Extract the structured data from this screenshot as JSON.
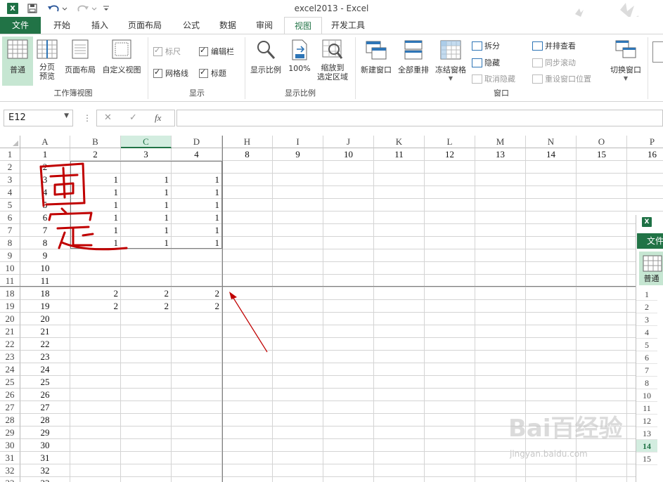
{
  "window": {
    "title": "excel2013 - Excel"
  },
  "tabs": [
    "文件",
    "开始",
    "插入",
    "页面布局",
    "公式",
    "数据",
    "审阅",
    "视图",
    "开发工具"
  ],
  "ribbon": {
    "views": {
      "normal": "普通",
      "page_break_1": "分页",
      "page_break_2": "预览",
      "page_layout": "页面布局",
      "custom": "自定义视图",
      "group": "工作簿视图"
    },
    "show": {
      "ruler": "标尺",
      "formula_bar": "编辑栏",
      "gridlines": "网格线",
      "headings": "标题",
      "group": "显示"
    },
    "zoom": {
      "zoom": "显示比例",
      "hundred": "100%",
      "sel_1": "缩放到",
      "sel_2": "选定区域",
      "group": "显示比例"
    },
    "window": {
      "new_window": "新建窗口",
      "arrange_all": "全部重排",
      "freeze": "冻结窗格",
      "split": "拆分",
      "hide": "隐藏",
      "unhide": "取消隐藏",
      "side_by_side": "并排查看",
      "sync_scroll": "同步滚动",
      "reset_position": "重设窗口位置",
      "switch": "切换窗口",
      "group": "窗口"
    }
  },
  "formula_bar": {
    "name_box": "E12",
    "cancel": "✕",
    "enter": "✓",
    "fx": "fx",
    "value": ""
  },
  "columns": [
    "A",
    "B",
    "C",
    "D",
    "H",
    "I",
    "J",
    "K",
    "L",
    "M",
    "N",
    "O",
    "P"
  ],
  "selected_column": "C",
  "rows": [
    {
      "n": "1",
      "cells": [
        "1",
        "2",
        "3",
        "4",
        "8",
        "9",
        "10",
        "11",
        "12",
        "13",
        "14",
        "15",
        "16"
      ]
    },
    {
      "n": "2",
      "cells": [
        "2",
        "",
        "",
        "",
        "",
        "",
        "",
        "",
        "",
        "",
        "",
        "",
        ""
      ]
    },
    {
      "n": "3",
      "cells": [
        "3",
        "1",
        "1",
        "1",
        "",
        "",
        "",
        "",
        "",
        "",
        "",
        "",
        ""
      ]
    },
    {
      "n": "4",
      "cells": [
        "4",
        "1",
        "1",
        "1",
        "",
        "",
        "",
        "",
        "",
        "",
        "",
        "",
        ""
      ]
    },
    {
      "n": "5",
      "cells": [
        "5",
        "1",
        "1",
        "1",
        "",
        "",
        "",
        "",
        "",
        "",
        "",
        "",
        ""
      ]
    },
    {
      "n": "6",
      "cells": [
        "6",
        "1",
        "1",
        "1",
        "",
        "",
        "",
        "",
        "",
        "",
        "",
        "",
        ""
      ]
    },
    {
      "n": "7",
      "cells": [
        "7",
        "1",
        "1",
        "1",
        "",
        "",
        "",
        "",
        "",
        "",
        "",
        "",
        ""
      ]
    },
    {
      "n": "8",
      "cells": [
        "8",
        "1",
        "1",
        "1",
        "",
        "",
        "",
        "",
        "",
        "",
        "",
        "",
        ""
      ]
    },
    {
      "n": "9",
      "cells": [
        "9",
        "",
        "",
        "",
        "",
        "",
        "",
        "",
        "",
        "",
        "",
        "",
        ""
      ]
    },
    {
      "n": "10",
      "cells": [
        "10",
        "",
        "",
        "",
        "",
        "",
        "",
        "",
        "",
        "",
        "",
        "",
        ""
      ]
    },
    {
      "n": "11",
      "cells": [
        "11",
        "",
        "",
        "",
        "",
        "",
        "",
        "",
        "",
        "",
        "",
        "",
        ""
      ]
    },
    {
      "n": "18",
      "cells": [
        "18",
        "2",
        "2",
        "2",
        "",
        "",
        "",
        "",
        "",
        "",
        "",
        "",
        ""
      ]
    },
    {
      "n": "19",
      "cells": [
        "19",
        "2",
        "2",
        "2",
        "",
        "",
        "",
        "",
        "",
        "",
        "",
        "",
        ""
      ]
    },
    {
      "n": "20",
      "cells": [
        "20",
        "",
        "",
        "",
        "",
        "",
        "",
        "",
        "",
        "",
        "",
        "",
        ""
      ]
    },
    {
      "n": "21",
      "cells": [
        "21",
        "",
        "",
        "",
        "",
        "",
        "",
        "",
        "",
        "",
        "",
        "",
        ""
      ]
    },
    {
      "n": "22",
      "cells": [
        "22",
        "",
        "",
        "",
        "",
        "",
        "",
        "",
        "",
        "",
        "",
        "",
        ""
      ]
    },
    {
      "n": "23",
      "cells": [
        "23",
        "",
        "",
        "",
        "",
        "",
        "",
        "",
        "",
        "",
        "",
        "",
        ""
      ]
    },
    {
      "n": "24",
      "cells": [
        "24",
        "",
        "",
        "",
        "",
        "",
        "",
        "",
        "",
        "",
        "",
        "",
        ""
      ]
    },
    {
      "n": "25",
      "cells": [
        "25",
        "",
        "",
        "",
        "",
        "",
        "",
        "",
        "",
        "",
        "",
        "",
        ""
      ]
    },
    {
      "n": "26",
      "cells": [
        "26",
        "",
        "",
        "",
        "",
        "",
        "",
        "",
        "",
        "",
        "",
        "",
        ""
      ]
    },
    {
      "n": "27",
      "cells": [
        "27",
        "",
        "",
        "",
        "",
        "",
        "",
        "",
        "",
        "",
        "",
        "",
        ""
      ]
    },
    {
      "n": "28",
      "cells": [
        "28",
        "",
        "",
        "",
        "",
        "",
        "",
        "",
        "",
        "",
        "",
        "",
        ""
      ]
    },
    {
      "n": "29",
      "cells": [
        "29",
        "",
        "",
        "",
        "",
        "",
        "",
        "",
        "",
        "",
        "",
        "",
        ""
      ]
    },
    {
      "n": "30",
      "cells": [
        "30",
        "",
        "",
        "",
        "",
        "",
        "",
        "",
        "",
        "",
        "",
        "",
        ""
      ]
    },
    {
      "n": "31",
      "cells": [
        "31",
        "",
        "",
        "",
        "",
        "",
        "",
        "",
        "",
        "",
        "",
        "",
        ""
      ]
    },
    {
      "n": "32",
      "cells": [
        "32",
        "",
        "",
        "",
        "",
        "",
        "",
        "",
        "",
        "",
        "",
        "",
        ""
      ]
    },
    {
      "n": "33",
      "cells": [
        "33",
        "",
        "",
        "",
        "",
        "",
        "",
        "",
        "",
        "",
        "",
        "",
        ""
      ]
    }
  ],
  "annotation": {
    "text": "固定",
    "color": "#c00000"
  },
  "second_window": {
    "tab": "文件",
    "button": "普通",
    "rows": [
      "1",
      "2",
      "3",
      "4",
      "5",
      "6",
      "7",
      "8",
      "10",
      "11",
      "12",
      "13",
      "14",
      "15"
    ],
    "selected_row": "14"
  },
  "watermark": {
    "text": "Bai百经验",
    "url": "jingyan.baidu.com"
  }
}
